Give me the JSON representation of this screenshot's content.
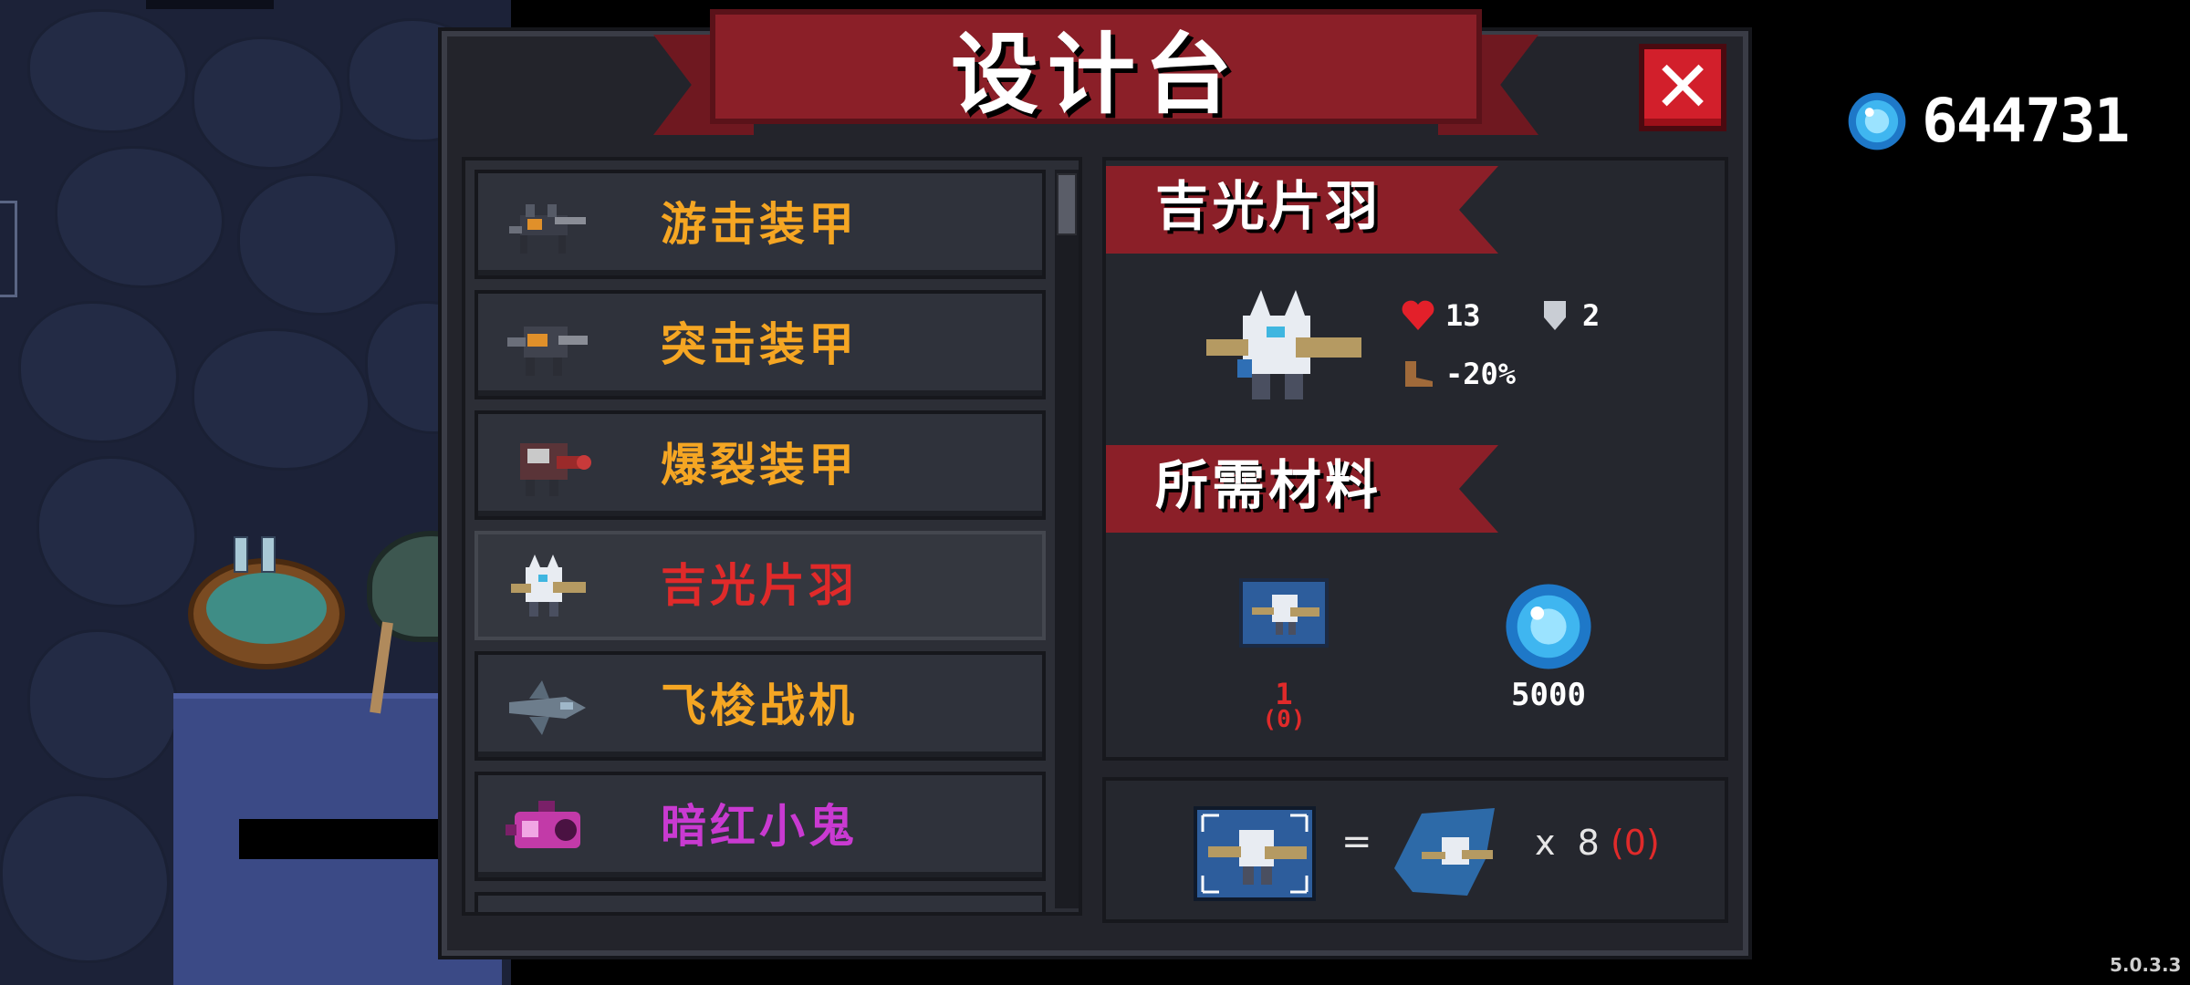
{
  "title": "设计台",
  "close_label": "✕",
  "currency": {
    "icon": "blue-gem-icon",
    "amount": "644731"
  },
  "version": "5.0.3.3",
  "list": {
    "items": [
      {
        "label": "游击装甲",
        "color": "#f5a623",
        "icon": "mech-guerrilla-icon"
      },
      {
        "label": "突击装甲",
        "color": "#f5a623",
        "icon": "mech-assault-icon"
      },
      {
        "label": "爆裂装甲",
        "color": "#f5a623",
        "icon": "mech-burst-icon"
      },
      {
        "label": "吉光片羽",
        "color": "#e02a2a",
        "icon": "mech-jiguang-icon",
        "selected": true
      },
      {
        "label": "飞梭战机",
        "color": "#f5a623",
        "icon": "jet-fighter-icon"
      },
      {
        "label": "暗红小鬼",
        "color": "#c93ad1",
        "icon": "crimson-imp-icon"
      }
    ]
  },
  "detail": {
    "name": "吉光片羽",
    "stats": {
      "hp": "13",
      "armor": "2",
      "speed": "-20%"
    },
    "materials_title": "所需材料",
    "blueprint_need": "1",
    "blueprint_owned": "(0)",
    "gem_cost": "5000"
  },
  "recipe": {
    "equals": "=",
    "multiplier": "x",
    "count": "8",
    "owned": "(0)"
  }
}
